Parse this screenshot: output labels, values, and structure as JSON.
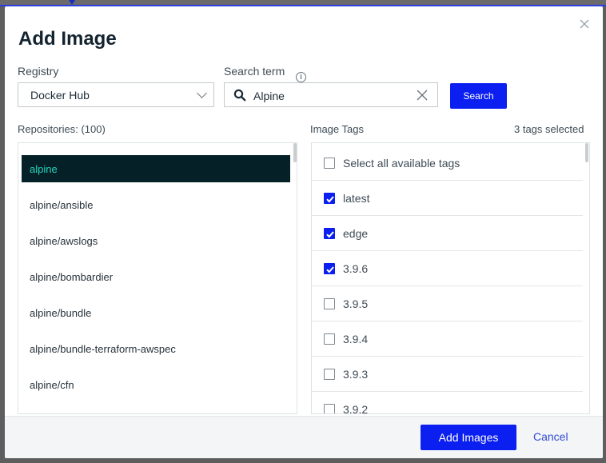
{
  "dialog": {
    "title": "Add Image",
    "close_icon": "close-icon"
  },
  "registry": {
    "label": "Registry",
    "selected": "Docker Hub"
  },
  "search": {
    "label": "Search term",
    "value": "Alpine",
    "button_label": "Search"
  },
  "repositories": {
    "label": "Repositories: (100)",
    "selected_index": 0,
    "items": [
      "alpine",
      "alpine/ansible",
      "alpine/awslogs",
      "alpine/bombardier",
      "alpine/bundle",
      "alpine/bundle-terraform-awspec",
      "alpine/cfn"
    ]
  },
  "tags": {
    "label": "Image Tags",
    "selected_count_text": "3 tags selected",
    "select_all_label": "Select all available tags",
    "items": [
      {
        "label": "latest",
        "checked": true
      },
      {
        "label": "edge",
        "checked": true
      },
      {
        "label": "3.9.6",
        "checked": true
      },
      {
        "label": "3.9.5",
        "checked": false
      },
      {
        "label": "3.9.4",
        "checked": false
      },
      {
        "label": "3.9.3",
        "checked": false
      },
      {
        "label": "3.9.2",
        "checked": false
      }
    ]
  },
  "footer": {
    "add_label": "Add Images",
    "cancel_label": "Cancel"
  },
  "colors": {
    "primary": "#0b1ff0",
    "selected_row_bg": "#052127",
    "selected_row_text": "#22d4bf"
  }
}
